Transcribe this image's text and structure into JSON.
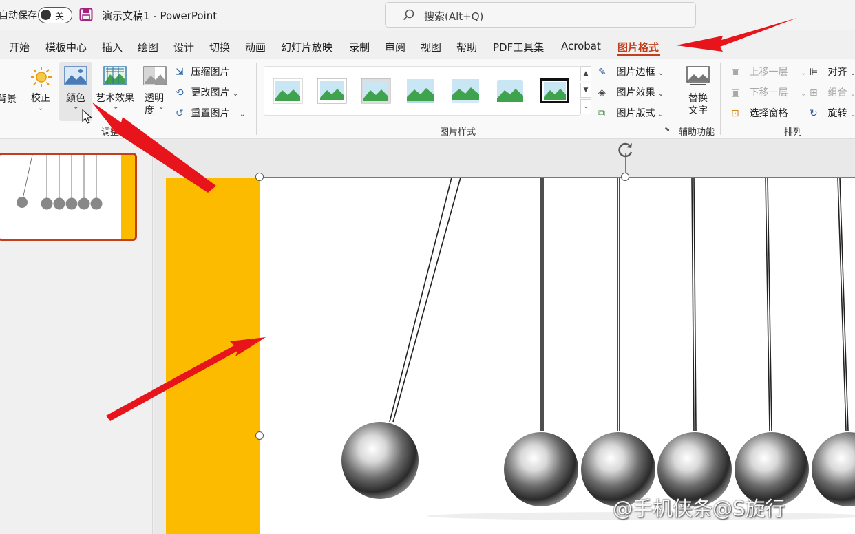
{
  "titlebar": {
    "autosave_label": "自动保存",
    "autosave_state": "关",
    "doc_title": "演示文稿1  -  PowerPoint",
    "search_placeholder": "搜索(Alt+Q)"
  },
  "tabs": [
    "开始",
    "模板中心",
    "插入",
    "绘图",
    "设计",
    "切换",
    "动画",
    "幻灯片放映",
    "录制",
    "审阅",
    "视图",
    "帮助",
    "PDF工具集",
    "Acrobat",
    "图片格式"
  ],
  "active_tab": "图片格式",
  "ribbon": {
    "bg_remove_label": "背景",
    "correct_label": "校正",
    "color_label": "颜色",
    "artistic_label": "艺术效果",
    "transparency_label_1": "透明",
    "transparency_label_2": "度",
    "compress_label": "压缩图片",
    "change_label": "更改图片",
    "reset_label": "重置图片",
    "adjust_group": "调整",
    "styles_group": "图片样式",
    "border_label": "图片边框",
    "effects_label": "图片效果",
    "layout_label": "图片版式",
    "alt_text_label_1": "替换",
    "alt_text_label_2": "文字",
    "accessibility_group": "辅助功能",
    "bring_forward_label": "上移一层",
    "send_backward_label": "下移一层",
    "selection_pane_label": "选择窗格",
    "align_label": "对齐",
    "group_label": "组合",
    "rotate_label": "旋转",
    "arrange_group": "排列"
  },
  "watermark": "@手机侠条@S旋行",
  "colors": {
    "accent": "#c43e1c",
    "slide_yellow": "#fdbb00",
    "arrow": "#e8141b"
  }
}
